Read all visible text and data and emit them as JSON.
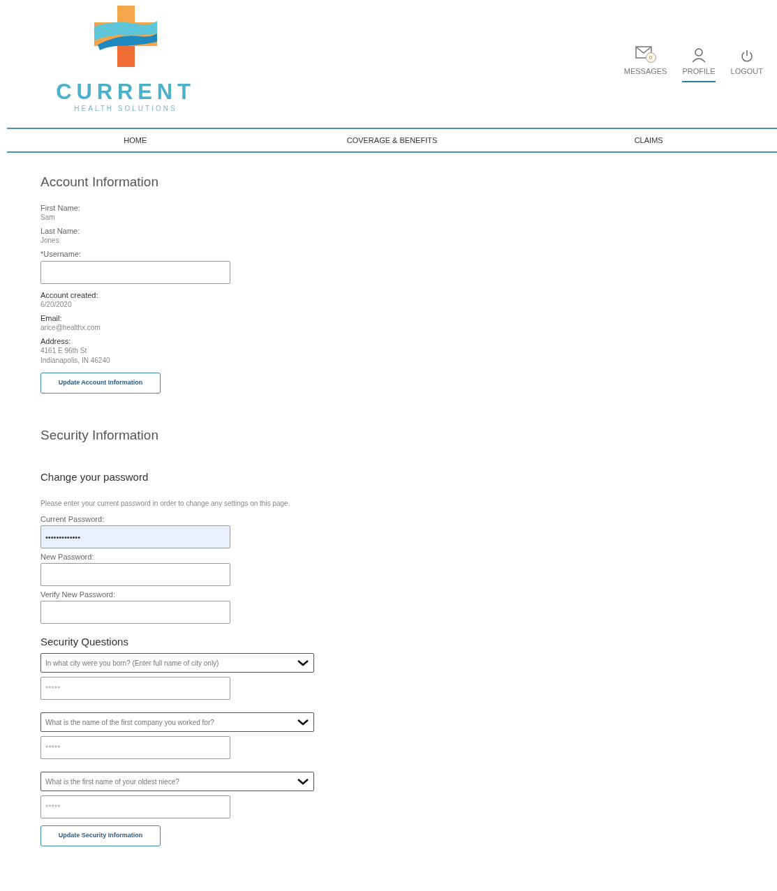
{
  "logo": {
    "name": "CURRENT",
    "tagline": "HEALTH SOLUTIONS"
  },
  "header_links": [
    {
      "kind": "messages",
      "label": "MESSAGES",
      "badge": "0",
      "selected": false
    },
    {
      "kind": "profile",
      "label": "PROFILE",
      "selected": true
    },
    {
      "kind": "logout",
      "label": "LOGOUT",
      "selected": false
    }
  ],
  "nav": [
    "HOME",
    "COVERAGE & BENEFITS",
    "CLAIMS"
  ],
  "account": {
    "title": "Account Information",
    "fields": [
      {
        "kind": "text",
        "label": "First Name:",
        "value": "Sam"
      },
      {
        "kind": "text",
        "label": "Last Name:",
        "value": "Jones"
      },
      {
        "kind": "input",
        "label": "*Username:"
      },
      {
        "kind": "strong",
        "label": "Account created:",
        "value": "6/20/2020"
      },
      {
        "kind": "strong",
        "label": "Email:",
        "value": "arice@healthx.com"
      },
      {
        "kind": "strong",
        "label": "Address:",
        "lines": [
          "4161 E 96th St",
          "Indianapolis, IN 46240"
        ]
      }
    ],
    "button": "Update Account Information"
  },
  "security": {
    "title": "Security Information",
    "subtitle": "Change your password",
    "note": "Please enter your current password in order to change any settings on this page.",
    "passwords": [
      {
        "label": "Current Password:",
        "value": "•••••••••••••",
        "filled": true
      },
      {
        "label": "New Password:",
        "filled": false
      },
      {
        "label": "Verify New Password:",
        "filled": false
      }
    ],
    "questions_title": "Security Questions",
    "questions": [
      {
        "question": "In what city were you born? (Enter full name of city only)",
        "answer_placeholder": "*****"
      },
      {
        "question": "What is the name of the first company you worked for?",
        "answer_placeholder": "*****"
      },
      {
        "question": "What is the first name of your oldest niece?",
        "answer_placeholder": "*****"
      }
    ],
    "button": "Update Security Information"
  }
}
